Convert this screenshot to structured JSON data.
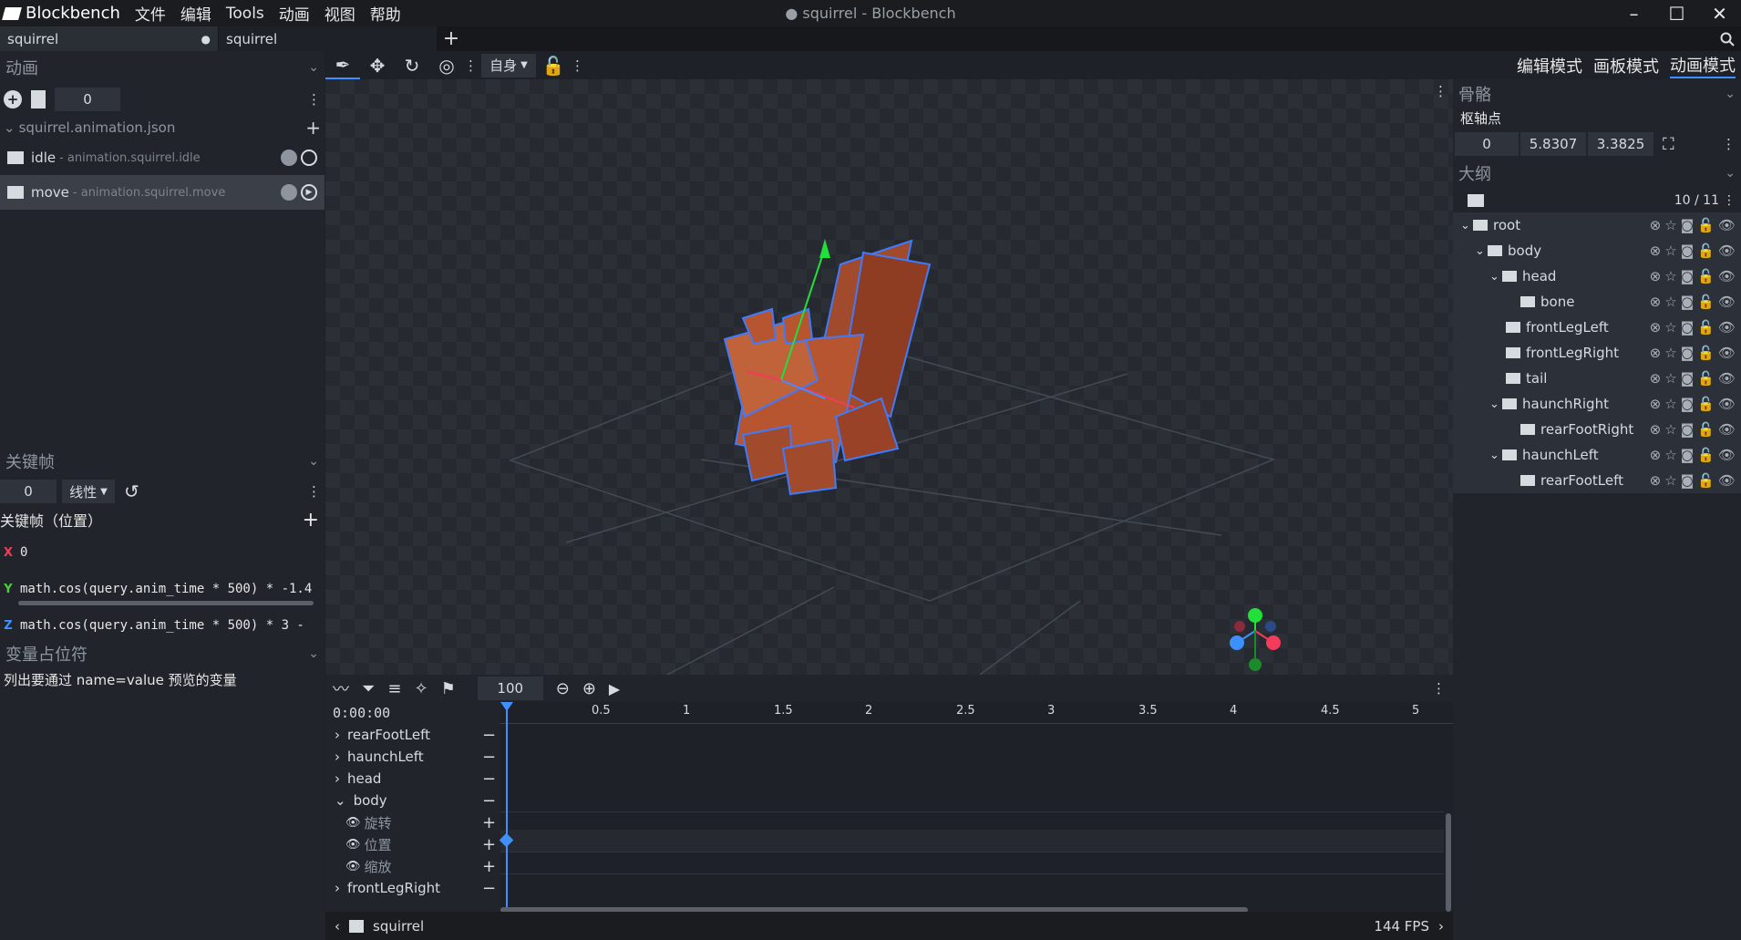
{
  "app": {
    "name": "Blockbench",
    "window_title": "● squirrel - Blockbench"
  },
  "menu": [
    "文件",
    "编辑",
    "Tools",
    "动画",
    "视图",
    "帮助"
  ],
  "tabs": [
    {
      "label": "squirrel",
      "modified": "●"
    },
    {
      "label": "squirrel",
      "modified": ""
    }
  ],
  "modes": [
    "编辑模式",
    "画板模式",
    "动画模式"
  ],
  "toolbar": {
    "space": "自身"
  },
  "animations": {
    "title": "动画",
    "counter": "0",
    "file": "squirrel.animation.json",
    "items": [
      {
        "name": "idle",
        "path": "- animation.squirrel.idle"
      },
      {
        "name": "move",
        "path": "- animation.squirrel.move"
      }
    ]
  },
  "keyframe": {
    "title": "关键帧",
    "time": "0",
    "interp": "线性",
    "section": "关键帧（位置）",
    "x": "0",
    "y": "math.cos(query.anim_time * 500) * -1.4",
    "z": "math.cos(query.anim_time * 500) * 3 -"
  },
  "variables": {
    "title": "变量占位符",
    "hint": "列出要通过 name=value 预览的变量"
  },
  "bone": {
    "title": "骨骼",
    "pivot_label": "枢轴点",
    "x": "0",
    "y": "5.8307",
    "z": "3.3825"
  },
  "outliner": {
    "title": "大纲",
    "count": "10 / 11",
    "items": [
      {
        "name": "root",
        "depth": 0,
        "caret": "⌄"
      },
      {
        "name": "body",
        "depth": 1,
        "caret": "⌄"
      },
      {
        "name": "head",
        "depth": 2,
        "caret": "⌄"
      },
      {
        "name": "bone",
        "depth": 3,
        "caret": ""
      },
      {
        "name": "frontLegLeft",
        "depth": 2,
        "caret": ""
      },
      {
        "name": "frontLegRight",
        "depth": 2,
        "caret": ""
      },
      {
        "name": "tail",
        "depth": 2,
        "caret": ""
      },
      {
        "name": "haunchRight",
        "depth": 2,
        "caret": "⌄"
      },
      {
        "name": "rearFootRight",
        "depth": 3,
        "caret": ""
      },
      {
        "name": "haunchLeft",
        "depth": 2,
        "caret": "⌄"
      },
      {
        "name": "rearFootLeft",
        "depth": 3,
        "caret": ""
      }
    ]
  },
  "timeline": {
    "zoom": "100",
    "time": "0:00:00",
    "ticks": [
      "0.5",
      "1",
      "1.5",
      "2",
      "2.5",
      "3",
      "3.5",
      "4",
      "4.5",
      "5"
    ],
    "rows": [
      {
        "label": "rearFootLeft",
        "type": "bone"
      },
      {
        "label": "haunchLeft",
        "type": "bone"
      },
      {
        "label": "head",
        "type": "bone"
      },
      {
        "label": "body",
        "type": "bone-open"
      },
      {
        "label": "旋转",
        "type": "channel"
      },
      {
        "label": "位置",
        "type": "channel"
      },
      {
        "label": "缩放",
        "type": "channel"
      },
      {
        "label": "frontLegRight",
        "type": "bone"
      }
    ]
  },
  "status": {
    "project": "squirrel",
    "fps": "144 FPS"
  }
}
